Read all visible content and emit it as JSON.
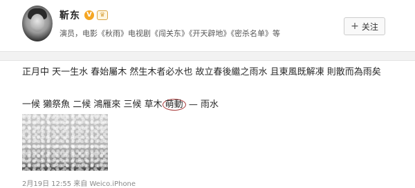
{
  "profile": {
    "name": "靳东",
    "verified_badge": "V",
    "rank_badge": "",
    "bio_prefix": "演员，电影《",
    "works": [
      {
        "title": "秋雨",
        "sep": "》电视剧《"
      },
      {
        "title": "闯关东",
        "sep": "》《"
      },
      {
        "title": "开天辟地",
        "sep": "》《"
      },
      {
        "title": "密杀名单",
        "sep": "》等"
      }
    ],
    "follow_label": "关注",
    "follow_icon": "+"
  },
  "post": {
    "text_line1": "正月中 天一生水 春始屬木 然生木者必水也 故立春後繼之雨水 且東風既解凍 則散而為雨矣",
    "line2_before": "一候 獺祭魚 二候 鴻雁來 三候 草木",
    "line2_circled": "萌動",
    "line2_after": " — 雨水",
    "meta": "2月19日 12:55 来自 Weico.iPhone",
    "colors": {
      "circle": "#a83a3a",
      "text": "#2a2a2a"
    }
  }
}
